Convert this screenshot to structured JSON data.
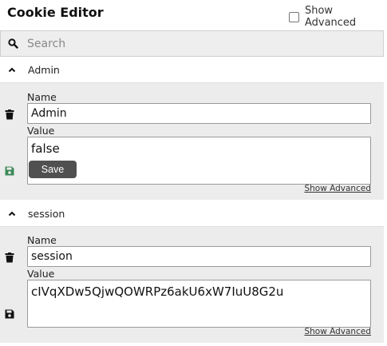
{
  "app": {
    "title": "Cookie Editor",
    "show_advanced_label": "Show Advanced"
  },
  "search": {
    "placeholder": "Search"
  },
  "cookies": [
    {
      "name": "Admin",
      "name_label": "Name",
      "value_label": "Value",
      "name_value": "Admin",
      "value": "false",
      "save_label": "Save",
      "advanced_link": "Show Advanced"
    },
    {
      "name": "session",
      "name_label": "Name",
      "value_label": "Value",
      "name_value": "session",
      "value": "cIVqXDw5QjwQOWRPz6akU6xW7IuU8G2u",
      "advanced_link": "Show Advanced"
    }
  ],
  "colors": {
    "save_icon_dirty": "#3d8a5a",
    "save_icon": "#111111",
    "accent_dark": "#505050"
  }
}
